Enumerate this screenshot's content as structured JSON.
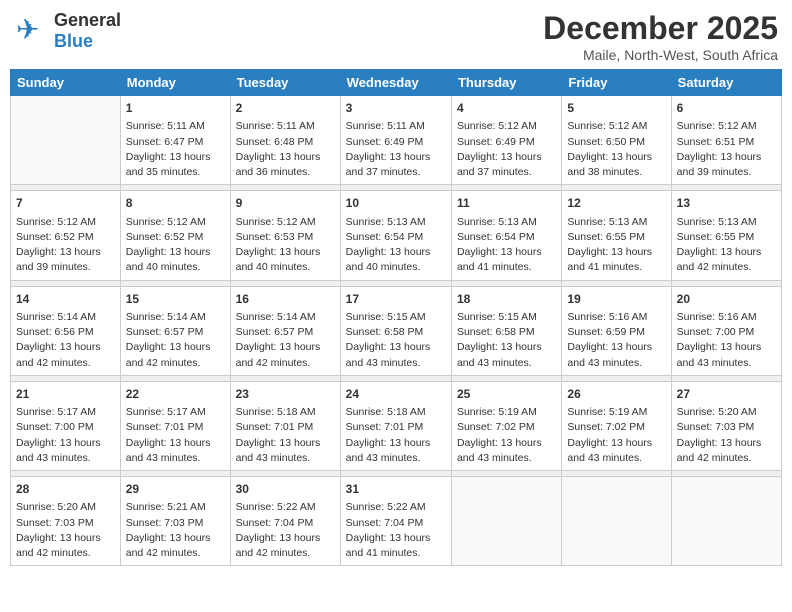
{
  "logo": {
    "general": "General",
    "blue": "Blue"
  },
  "title": "December 2025",
  "subtitle": "Maile, North-West, South Africa",
  "days_of_week": [
    "Sunday",
    "Monday",
    "Tuesday",
    "Wednesday",
    "Thursday",
    "Friday",
    "Saturday"
  ],
  "weeks": [
    [
      {
        "day": "",
        "sunrise": "",
        "sunset": "",
        "daylight": ""
      },
      {
        "day": "1",
        "sunrise": "Sunrise: 5:11 AM",
        "sunset": "Sunset: 6:47 PM",
        "daylight": "Daylight: 13 hours and 35 minutes."
      },
      {
        "day": "2",
        "sunrise": "Sunrise: 5:11 AM",
        "sunset": "Sunset: 6:48 PM",
        "daylight": "Daylight: 13 hours and 36 minutes."
      },
      {
        "day": "3",
        "sunrise": "Sunrise: 5:11 AM",
        "sunset": "Sunset: 6:49 PM",
        "daylight": "Daylight: 13 hours and 37 minutes."
      },
      {
        "day": "4",
        "sunrise": "Sunrise: 5:12 AM",
        "sunset": "Sunset: 6:49 PM",
        "daylight": "Daylight: 13 hours and 37 minutes."
      },
      {
        "day": "5",
        "sunrise": "Sunrise: 5:12 AM",
        "sunset": "Sunset: 6:50 PM",
        "daylight": "Daylight: 13 hours and 38 minutes."
      },
      {
        "day": "6",
        "sunrise": "Sunrise: 5:12 AM",
        "sunset": "Sunset: 6:51 PM",
        "daylight": "Daylight: 13 hours and 39 minutes."
      }
    ],
    [
      {
        "day": "7",
        "sunrise": "Sunrise: 5:12 AM",
        "sunset": "Sunset: 6:52 PM",
        "daylight": "Daylight: 13 hours and 39 minutes."
      },
      {
        "day": "8",
        "sunrise": "Sunrise: 5:12 AM",
        "sunset": "Sunset: 6:52 PM",
        "daylight": "Daylight: 13 hours and 40 minutes."
      },
      {
        "day": "9",
        "sunrise": "Sunrise: 5:12 AM",
        "sunset": "Sunset: 6:53 PM",
        "daylight": "Daylight: 13 hours and 40 minutes."
      },
      {
        "day": "10",
        "sunrise": "Sunrise: 5:13 AM",
        "sunset": "Sunset: 6:54 PM",
        "daylight": "Daylight: 13 hours and 40 minutes."
      },
      {
        "day": "11",
        "sunrise": "Sunrise: 5:13 AM",
        "sunset": "Sunset: 6:54 PM",
        "daylight": "Daylight: 13 hours and 41 minutes."
      },
      {
        "day": "12",
        "sunrise": "Sunrise: 5:13 AM",
        "sunset": "Sunset: 6:55 PM",
        "daylight": "Daylight: 13 hours and 41 minutes."
      },
      {
        "day": "13",
        "sunrise": "Sunrise: 5:13 AM",
        "sunset": "Sunset: 6:55 PM",
        "daylight": "Daylight: 13 hours and 42 minutes."
      }
    ],
    [
      {
        "day": "14",
        "sunrise": "Sunrise: 5:14 AM",
        "sunset": "Sunset: 6:56 PM",
        "daylight": "Daylight: 13 hours and 42 minutes."
      },
      {
        "day": "15",
        "sunrise": "Sunrise: 5:14 AM",
        "sunset": "Sunset: 6:57 PM",
        "daylight": "Daylight: 13 hours and 42 minutes."
      },
      {
        "day": "16",
        "sunrise": "Sunrise: 5:14 AM",
        "sunset": "Sunset: 6:57 PM",
        "daylight": "Daylight: 13 hours and 42 minutes."
      },
      {
        "day": "17",
        "sunrise": "Sunrise: 5:15 AM",
        "sunset": "Sunset: 6:58 PM",
        "daylight": "Daylight: 13 hours and 43 minutes."
      },
      {
        "day": "18",
        "sunrise": "Sunrise: 5:15 AM",
        "sunset": "Sunset: 6:58 PM",
        "daylight": "Daylight: 13 hours and 43 minutes."
      },
      {
        "day": "19",
        "sunrise": "Sunrise: 5:16 AM",
        "sunset": "Sunset: 6:59 PM",
        "daylight": "Daylight: 13 hours and 43 minutes."
      },
      {
        "day": "20",
        "sunrise": "Sunrise: 5:16 AM",
        "sunset": "Sunset: 7:00 PM",
        "daylight": "Daylight: 13 hours and 43 minutes."
      }
    ],
    [
      {
        "day": "21",
        "sunrise": "Sunrise: 5:17 AM",
        "sunset": "Sunset: 7:00 PM",
        "daylight": "Daylight: 13 hours and 43 minutes."
      },
      {
        "day": "22",
        "sunrise": "Sunrise: 5:17 AM",
        "sunset": "Sunset: 7:01 PM",
        "daylight": "Daylight: 13 hours and 43 minutes."
      },
      {
        "day": "23",
        "sunrise": "Sunrise: 5:18 AM",
        "sunset": "Sunset: 7:01 PM",
        "daylight": "Daylight: 13 hours and 43 minutes."
      },
      {
        "day": "24",
        "sunrise": "Sunrise: 5:18 AM",
        "sunset": "Sunset: 7:01 PM",
        "daylight": "Daylight: 13 hours and 43 minutes."
      },
      {
        "day": "25",
        "sunrise": "Sunrise: 5:19 AM",
        "sunset": "Sunset: 7:02 PM",
        "daylight": "Daylight: 13 hours and 43 minutes."
      },
      {
        "day": "26",
        "sunrise": "Sunrise: 5:19 AM",
        "sunset": "Sunset: 7:02 PM",
        "daylight": "Daylight: 13 hours and 43 minutes."
      },
      {
        "day": "27",
        "sunrise": "Sunrise: 5:20 AM",
        "sunset": "Sunset: 7:03 PM",
        "daylight": "Daylight: 13 hours and 42 minutes."
      }
    ],
    [
      {
        "day": "28",
        "sunrise": "Sunrise: 5:20 AM",
        "sunset": "Sunset: 7:03 PM",
        "daylight": "Daylight: 13 hours and 42 minutes."
      },
      {
        "day": "29",
        "sunrise": "Sunrise: 5:21 AM",
        "sunset": "Sunset: 7:03 PM",
        "daylight": "Daylight: 13 hours and 42 minutes."
      },
      {
        "day": "30",
        "sunrise": "Sunrise: 5:22 AM",
        "sunset": "Sunset: 7:04 PM",
        "daylight": "Daylight: 13 hours and 42 minutes."
      },
      {
        "day": "31",
        "sunrise": "Sunrise: 5:22 AM",
        "sunset": "Sunset: 7:04 PM",
        "daylight": "Daylight: 13 hours and 41 minutes."
      },
      {
        "day": "",
        "sunrise": "",
        "sunset": "",
        "daylight": ""
      },
      {
        "day": "",
        "sunrise": "",
        "sunset": "",
        "daylight": ""
      },
      {
        "day": "",
        "sunrise": "",
        "sunset": "",
        "daylight": ""
      }
    ]
  ]
}
